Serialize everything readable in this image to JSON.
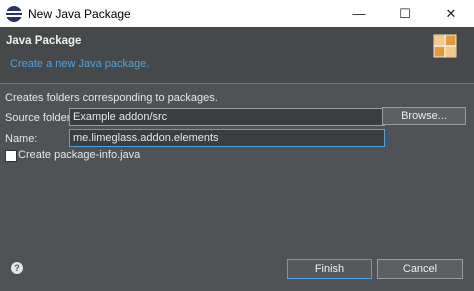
{
  "window": {
    "title": "New Java Package",
    "minimize_glyph": "—",
    "maximize_glyph": "☐",
    "close_glyph": "✕"
  },
  "header": {
    "title": "Java Package",
    "subtitle": "Create a new Java package."
  },
  "content": {
    "description": "Creates folders corresponding to packages.",
    "source_folder_label": "Source folder:",
    "source_folder_value": "Example addon/src",
    "browse_label": "Browse...",
    "name_label": "Name:",
    "name_value": "me.limeglass.addon.elements",
    "package_info_label": "Create package-info.java",
    "package_info_checked": false
  },
  "footer": {
    "help_glyph": "?",
    "finish_label": "Finish",
    "cancel_label": "Cancel"
  },
  "colors": {
    "accent": "#4aa4e2",
    "background": "#4f5355",
    "header_bg": "#46494a"
  }
}
